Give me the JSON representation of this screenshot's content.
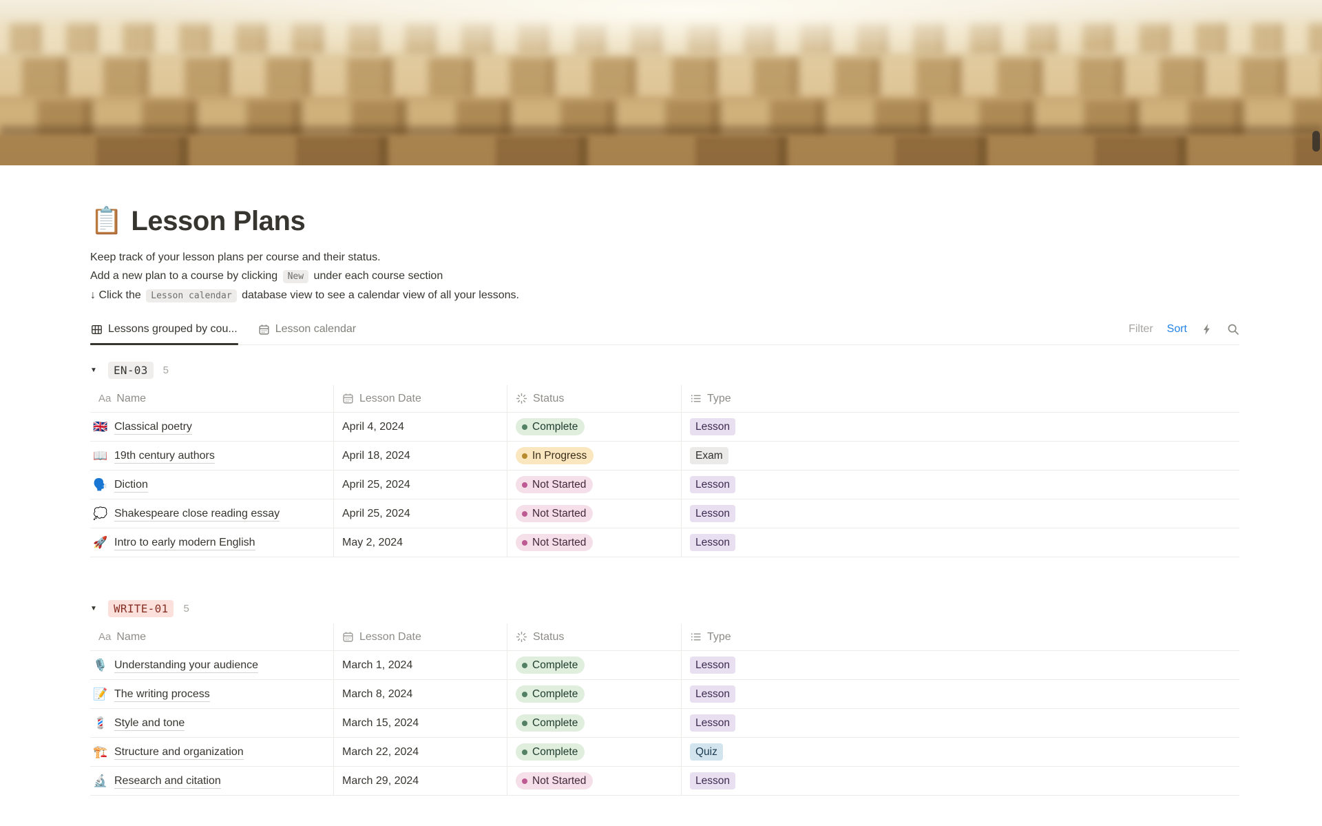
{
  "cover": {
    "image_description": "blurred rows of wooden auditorium seats"
  },
  "page": {
    "icon": "📋",
    "title": "Lesson Plans"
  },
  "description": {
    "line1": "Keep track of your lesson plans per course and their status.",
    "line2_before": "Add a new plan to a course by clicking",
    "line2_code": "New",
    "line2_after": "under each course section",
    "line3_before": "↓ Click the",
    "line3_code": "Lesson calendar",
    "line3_after": "database view to see a calendar view of all your lessons."
  },
  "view_tabs": [
    {
      "label": "Lessons grouped by cou...",
      "icon": "table-icon",
      "active": true
    },
    {
      "label": "Lesson calendar",
      "icon": "calendar-icon",
      "active": false
    }
  ],
  "toolbar": {
    "filter_label": "Filter",
    "sort_label": "Sort",
    "icons": [
      "bolt-icon",
      "search-icon"
    ]
  },
  "table": {
    "columns": [
      {
        "label": "Name",
        "icon": "aa-icon"
      },
      {
        "label": "Lesson Date",
        "icon": "calendar-icon"
      },
      {
        "label": "Status",
        "icon": "spinner-icon"
      },
      {
        "label": "Type",
        "icon": "list-icon"
      }
    ]
  },
  "groups": [
    {
      "name": "EN-03",
      "count": "5",
      "color": "gray",
      "rows": [
        {
          "emoji": "🇬🇧",
          "name": "Classical poetry",
          "date": "April 4, 2024",
          "status": "Complete",
          "status_color": "green",
          "type": "Lesson",
          "type_color": "purple"
        },
        {
          "emoji": "📖",
          "name": "19th century authors",
          "date": "April 18, 2024",
          "status": "In Progress",
          "status_color": "yellow",
          "type": "Exam",
          "type_color": "gray"
        },
        {
          "emoji": "🗣️",
          "name": "Diction",
          "date": "April 25, 2024",
          "status": "Not Started",
          "status_color": "pink",
          "type": "Lesson",
          "type_color": "purple"
        },
        {
          "emoji": "💭",
          "name": "Shakespeare close reading essay",
          "date": "April 25, 2024",
          "status": "Not Started",
          "status_color": "pink",
          "type": "Lesson",
          "type_color": "purple"
        },
        {
          "emoji": "🚀",
          "name": "Intro to early modern English",
          "date": "May 2, 2024",
          "status": "Not Started",
          "status_color": "pink",
          "type": "Lesson",
          "type_color": "purple"
        }
      ]
    },
    {
      "name": "WRITE-01",
      "count": "5",
      "color": "red",
      "rows": [
        {
          "emoji": "🎙️",
          "name": "Understanding your audience",
          "date": "March 1, 2024",
          "status": "Complete",
          "status_color": "green",
          "type": "Lesson",
          "type_color": "purple"
        },
        {
          "emoji": "📝",
          "name": "The writing process",
          "date": "March 8, 2024",
          "status": "Complete",
          "status_color": "green",
          "type": "Lesson",
          "type_color": "purple"
        },
        {
          "emoji": "💈",
          "name": "Style and tone",
          "date": "March 15, 2024",
          "status": "Complete",
          "status_color": "green",
          "type": "Lesson",
          "type_color": "purple"
        },
        {
          "emoji": "🏗️",
          "name": "Structure and organization",
          "date": "March 22, 2024",
          "status": "Complete",
          "status_color": "green",
          "type": "Quiz",
          "type_color": "blue"
        },
        {
          "emoji": "🔬",
          "name": "Research and citation",
          "date": "March 29, 2024",
          "status": "Not Started",
          "status_color": "pink",
          "type": "Lesson",
          "type_color": "purple"
        }
      ]
    }
  ],
  "colors": {
    "status": {
      "green": {
        "bg": "#DFEEDD",
        "dot": "#548164",
        "text": "#1F3B2C"
      },
      "yellow": {
        "bg": "#FAE7C0",
        "dot": "#B78A2F",
        "text": "#3A2E1A"
      },
      "pink": {
        "bg": "#F5DFE8",
        "dot": "#BE5A93",
        "text": "#43293A"
      }
    },
    "type": {
      "purple": {
        "bg": "#E8DFF0",
        "text": "#3E2C51"
      },
      "gray": {
        "bg": "#EBEAE8",
        "text": "#32302C"
      },
      "blue": {
        "bg": "#D2E4EE",
        "text": "#1B3A4F"
      }
    },
    "group": {
      "gray": {
        "bg": "#EFEEEC",
        "text": "#37352F"
      },
      "red": {
        "bg": "#FBE0DB",
        "text": "#872F25"
      }
    },
    "sort_accent": "#2383E2"
  }
}
